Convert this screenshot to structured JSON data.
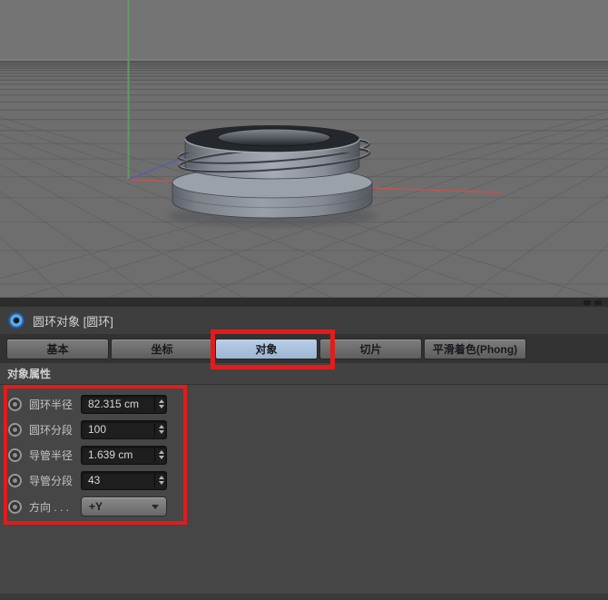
{
  "viewport": {
    "description": "C4D perspective viewport showing a thin torus wrapped around a two-tier cylinder cap model on a ground grid",
    "background": "#6e6e6e",
    "grid_line_color": "#565656",
    "axis_colors": {
      "x": "#c0554e",
      "y": "#619a61",
      "z": "#5c5ca8"
    }
  },
  "attribute_panel": {
    "title": "圆环对象 [圆环]",
    "title_icon": "torus-icon",
    "icon_color": "#4a9be8",
    "tabs": [
      {
        "label": "基本",
        "selected": false
      },
      {
        "label": "坐标",
        "selected": false
      },
      {
        "label": "对象",
        "selected": true
      },
      {
        "label": "切片",
        "selected": false
      },
      {
        "label": "平滑着色(Phong)",
        "selected": false
      }
    ],
    "selected_tab_color": "#a9c2dd",
    "section_title": "对象属性",
    "properties": [
      {
        "label": "圆环半径",
        "value": "82.315 cm",
        "control": "stepper"
      },
      {
        "label": "圆环分段",
        "value": "100",
        "control": "stepper"
      },
      {
        "label": "导管半径",
        "value": "1.639 cm",
        "control": "stepper"
      },
      {
        "label": "导管分段",
        "value": "43",
        "control": "stepper"
      },
      {
        "label": "方向 . . .",
        "value": "+Y",
        "control": "dropdown"
      }
    ]
  },
  "annotations": {
    "color": "#e31b1b",
    "boxes": [
      "object-tab-highlight",
      "object-properties-highlight"
    ]
  }
}
